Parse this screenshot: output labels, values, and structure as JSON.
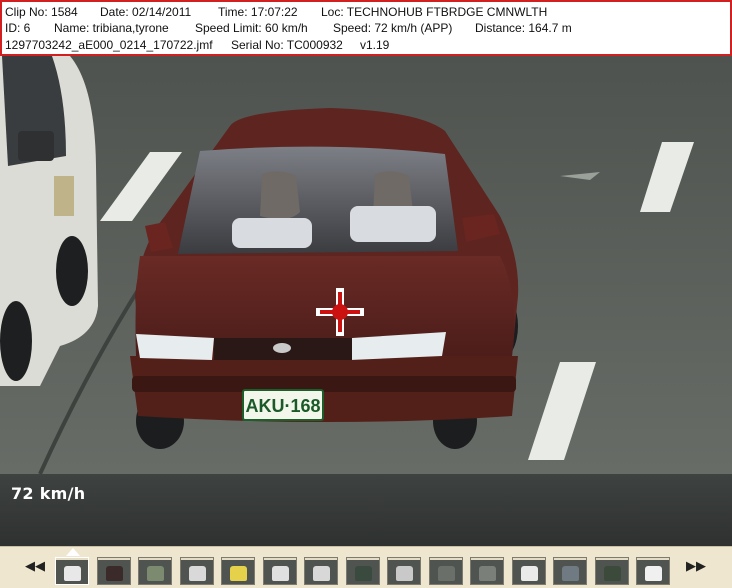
{
  "info": {
    "clip_no": "Clip No: 1584",
    "date": "Date: 02/14/2011",
    "time": "Time: 17:07:22",
    "loc": "Loc: TECHNOHUB FTBRDGE CMNWLTH",
    "id": "ID: 6",
    "name": "Name: tribiana,tyrone",
    "speed_limit": "Speed Limit: 60 km/h",
    "speed": "Speed: 72 km/h (APP)",
    "distance": "Distance: 164.7 m",
    "filename": "1297703242_aE000_0214_170722.jmf",
    "serial_no": "Serial No: TC000932",
    "version": "v1.19"
  },
  "image": {
    "plate": "AKU·168",
    "speed_overlay": "72 km/h"
  },
  "filmstrip": {
    "prev_label": "◀◀",
    "next_label": "▶▶",
    "selected_index": 0,
    "thumb_colors": [
      "#e8e8e8",
      "#3a2a2a",
      "#7c8a70",
      "#d9d9d9",
      "#e6d24a",
      "#e0e0e0",
      "#d8d8d8",
      "#3b4a3e",
      "#c9c9c9",
      "#6b6f6a",
      "#7a7f79",
      "#eaeaea",
      "#707a83",
      "#3c4a3c",
      "#f0f0f0"
    ]
  },
  "colors": {
    "border_red": "#d22020",
    "crosshair_red": "#cc1111",
    "car_maroon": "#5b2420"
  }
}
